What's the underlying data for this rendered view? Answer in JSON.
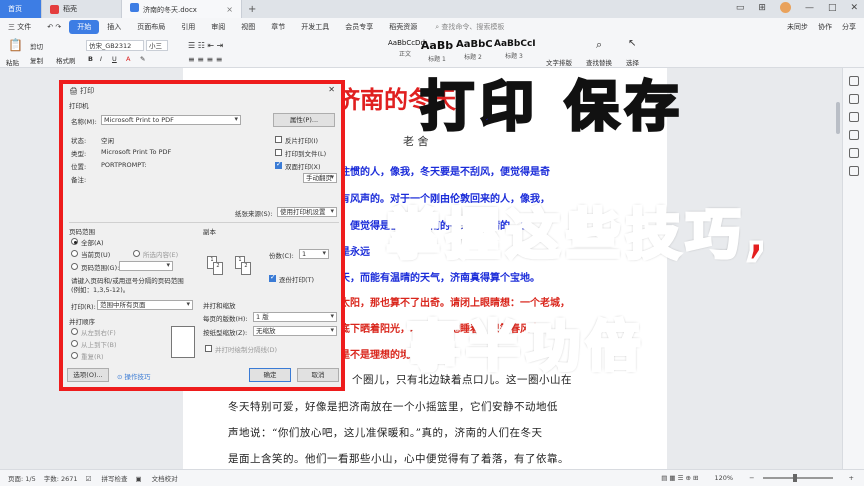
{
  "titlebar": {
    "home_tab": "首页",
    "tab1": "稻壳",
    "doc_tab": "济南的冬天.docx",
    "plus": "+"
  },
  "menubar": {
    "file": "三 文件",
    "items": [
      "开始",
      "插入",
      "页面布局",
      "引用",
      "审阅",
      "视图",
      "章节",
      "开发工具",
      "会员专享",
      "稻壳资源"
    ],
    "search": "查找命令、搜索模板",
    "right": [
      "未同步",
      "协作",
      "分享"
    ]
  },
  "ribbon": {
    "paste": "粘贴",
    "cut": "剪切",
    "copy": "复制",
    "format_painter": "格式刷",
    "font": "仿宋_GB2312",
    "size": "小三",
    "styles": [
      {
        "preview": "AaBbCcDd",
        "label": "正文"
      },
      {
        "preview": "AaBb",
        "label": "标题 1"
      },
      {
        "preview": "AaBbC",
        "label": "标题 2"
      },
      {
        "preview": "AaBbCcI",
        "label": "标题 3"
      }
    ],
    "text_layout": "文字排版",
    "find_replace": "查找替换",
    "select": "选择"
  },
  "document": {
    "title": "济南的冬天",
    "author": "老 舍",
    "blue_lines": [
      "住惯的人，像我，冬天要是不刮风，便觉得是奇",
      "有风声的。对于一个刚由伦敦回来的人，像我，",
      "，便觉得是怪事；济南的冬天是响晴的。自",
      "是永远",
      "天，而能有温晴的天气，济南真得算个宝地。"
    ],
    "red_lines": [
      "太阳，那也算不了出奇。请闭上眼睛想：一个老城，",
      "底下晒着阳光，暖和安适地睡着，只等春风来",
      "是不是理想的境界？小"
    ],
    "body_lines": [
      "个圈儿，只有北边缺着点口儿。这一圈小山在",
      "冬天特别可爱，好像是把济南放在一个小摇篮里，它们安静不动地低",
      "声地说：“你们放心吧，这儿准保暖和。”真的，济南的人们在冬天",
      "是面上含笑的。他们一看那些小山，心中便觉得有了着落，有了依靠。"
    ]
  },
  "dialog": {
    "title": "打印",
    "printer_group": "打印机",
    "name_label": "名称(M):",
    "printer_name": "Microsoft Print to PDF",
    "properties": "属性(P)...",
    "status_label": "状态:",
    "status_value": "空闲",
    "type_label": "类型:",
    "type_value": "Microsoft Print To PDF",
    "where_label": "位置:",
    "where_value": "PORTPROMPT:",
    "comment_label": "备注:",
    "reverse": "反片打印(I)",
    "print_to_file": "打印到文件(L)",
    "duplex": "双面打印(X)",
    "duplex_mode": "手动翻页",
    "paper_source_label": "纸张来源(S):",
    "paper_source": "使用打印机设置",
    "range_group": "页码范围",
    "all": "全部(A)",
    "current": "当前页(U)",
    "selection": "所选内容(E)",
    "pages": "页码范围(G):",
    "pages_hint": "请键入页码和/或用逗号分隔的页码范围",
    "pages_example": "(例如：1,3,5-12)。",
    "print_label": "打印(R):",
    "print_value": "范围中所有页面",
    "copies_group": "副本",
    "copies_label": "份数(C):",
    "copies_value": "1",
    "collate": "逐份打印(T)",
    "order_group": "并打顺序",
    "ltr": "从左到右(F)",
    "ttb": "从上到下(B)",
    "repeat": "重复(R)",
    "zoom_group": "并打和缩放",
    "pages_per_sheet_label": "每页的版数(H):",
    "pages_per_sheet": "1 版",
    "scale_label": "按纸型缩放(Z):",
    "scale_value": "无缩放",
    "draw_lines": "并打时绘制分隔线(D)",
    "options": "选项(O)...",
    "tips": "操作技巧",
    "ok": "确定",
    "cancel": "取消"
  },
  "overlay": {
    "line1": "打印 保存",
    "line2": "掌握这些技巧,",
    "line3": "事半功倍"
  },
  "statusbar": {
    "page": "页面: 1/5",
    "words": "字数: 2671",
    "spell": "拼写检查",
    "proof": "文档校对",
    "zoom": "120%"
  }
}
